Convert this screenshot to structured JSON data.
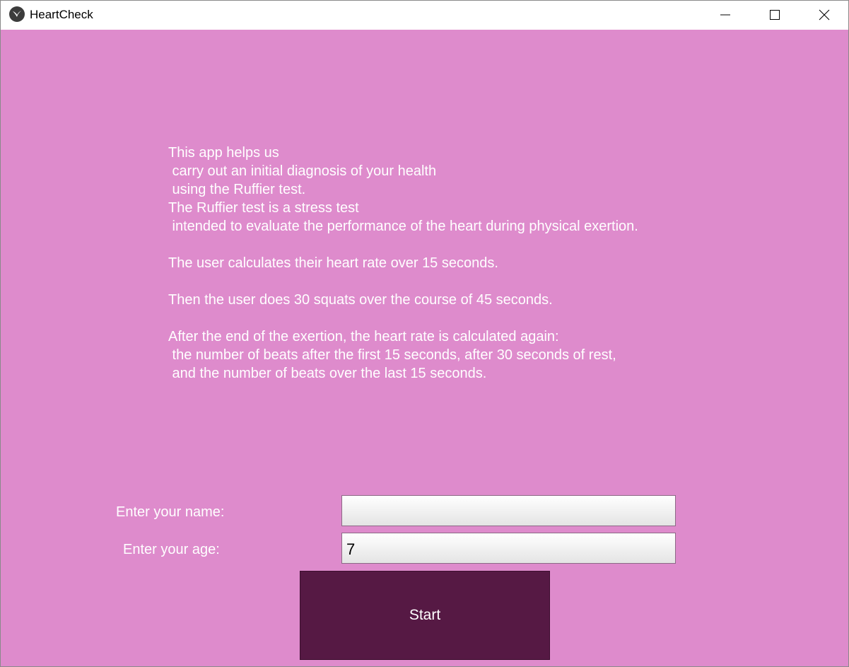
{
  "window": {
    "title": "HeartCheck",
    "icon": "kivy-logo-icon",
    "controls": [
      "minimize-icon",
      "maximize-icon",
      "close-icon"
    ]
  },
  "colors": {
    "background": "#de8bcc",
    "button": "#561944",
    "text": "#ffffff"
  },
  "instructions": {
    "text": "This app helps us\n carry out an initial diagnosis of your health\n using the Ruffier test.\nThe Ruffier test is a stress test\n intended to evaluate the performance of the heart during physical exertion.\n\nThe user calculates their heart rate over 15 seconds.\n\nThen the user does 30 squats over the course of 45 seconds.\n\nAfter the end of the exertion, the heart rate is calculated again:\n the number of beats after the first 15 seconds, after 30 seconds of rest,\n and the number of beats over the last 15 seconds."
  },
  "form": {
    "name_label": "Enter your name:",
    "name_value": "",
    "age_label": "Enter your age:",
    "age_value": "7",
    "start_label": "Start"
  }
}
